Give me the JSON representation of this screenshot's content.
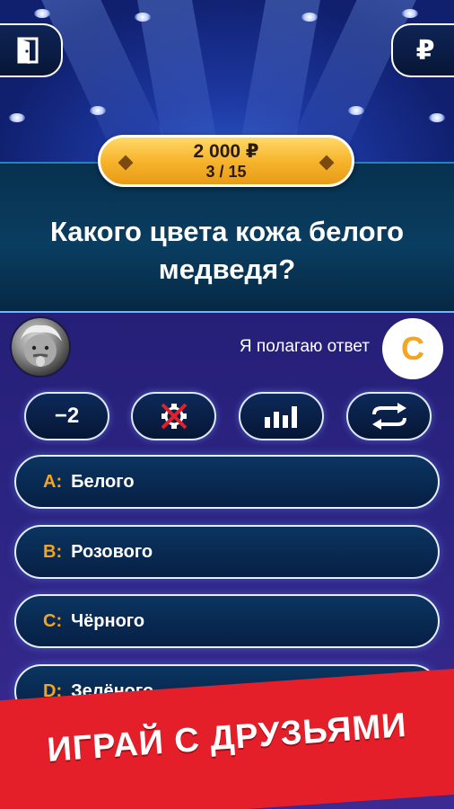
{
  "header": {
    "exit_icon": "door-exit-icon",
    "shop_icon": "ruble-icon",
    "shop_symbol": "₽"
  },
  "prize": {
    "amount": "2 000 ₽",
    "step": "3 / 15"
  },
  "question": {
    "text": "Какого цвета кожа белого медведя?"
  },
  "opponent": {
    "avatar": "einstein-avatar",
    "hint_text": "Я полагаю ответ",
    "hint_letter": "C"
  },
  "lifelines": [
    {
      "name": "minus-two",
      "label": "−2",
      "icon": "minus-two-icon"
    },
    {
      "name": "call-friend",
      "label": "",
      "icon": "crossed-out-lifeline-icon",
      "used": true
    },
    {
      "name": "audience",
      "label": "",
      "icon": "bar-chart-icon"
    },
    {
      "name": "swap",
      "label": "",
      "icon": "swap-arrows-icon"
    }
  ],
  "answers": [
    {
      "letter": "A:",
      "text": "Белого"
    },
    {
      "letter": "B:",
      "text": "Розового"
    },
    {
      "letter": "C:",
      "text": "Чёрного"
    },
    {
      "letter": "D:",
      "text": "Зелёного"
    }
  ],
  "banner": {
    "text": "ИГРАЙ С ДРУЗЬЯМИ"
  },
  "colors": {
    "accent_gold": "#f5a41f",
    "banner_red": "#e41f2a",
    "panel_navy": "#071f45",
    "background_purple": "#2c2482"
  }
}
